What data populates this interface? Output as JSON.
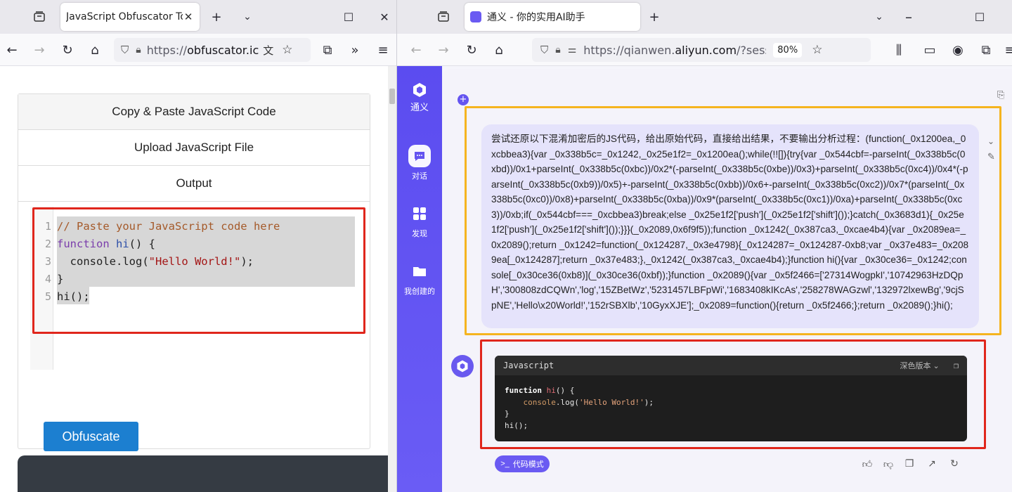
{
  "left_window": {
    "tab_title": "JavaScript Obfuscator Too",
    "url_prefix": "https://",
    "url_host": "obfuscator.ic",
    "page": {
      "accordion": [
        "Copy & Paste JavaScript Code",
        "Upload JavaScript File",
        "Output"
      ],
      "editor_lines": [
        {
          "num": "1"
        },
        {
          "num": "2"
        },
        {
          "num": "3"
        },
        {
          "num": "4"
        },
        {
          "num": "5"
        }
      ],
      "code": {
        "comment": "// Paste your JavaScript code here",
        "kw_function": "function",
        "fn_name": "hi",
        "sig_rest": "() {",
        "console_log": "  console.log(",
        "string": "\"Hello World!\"",
        "call_end": ");",
        "close_brace": "}",
        "call": "hi();"
      },
      "obfuscate_label": "Obfuscate"
    }
  },
  "right_window": {
    "tab_title": "通义 - 你的实用AI助手",
    "url_prefix": "https://qianwen.",
    "url_host": "aliyun.com",
    "url_rest": "/?sessionId=",
    "zoom": "80%",
    "sidebar": {
      "logo_label": "通义",
      "items": [
        {
          "label": "对话",
          "icon": "chat-icon"
        },
        {
          "label": "发现",
          "icon": "grid-icon"
        },
        {
          "label": "我创建的",
          "icon": "folder-icon"
        }
      ]
    },
    "user_message": "尝试还原以下混淆加密后的JS代码，给出原始代码，直接给出结果，不要输出分析过程：(function(_0x1200ea,_0xcbbea3){var _0x338b5c=_0x1242,_0x25e1f2=_0x1200ea();while(!![]){try{var _0x544cbf=-parseInt(_0x338b5c(0xbd))/0x1+parseInt(_0x338b5c(0xbc))/0x2*(-parseInt(_0x338b5c(0xbe))/0x3)+parseInt(_0x338b5c(0xc4))/0x4*(-parseInt(_0x338b5c(0xb9))/0x5)+-parseInt(_0x338b5c(0xbb))/0x6+-parseInt(_0x338b5c(0xc2))/0x7*(parseInt(_0x338b5c(0xc0))/0x8)+parseInt(_0x338b5c(0xba))/0x9*(parseInt(_0x338b5c(0xc1))/0xa)+parseInt(_0x338b5c(0xc3))/0xb;if(_0x544cbf===_0xcbbea3)break;else _0x25e1f2['push'](_0x25e1f2['shift']());}catch(_0x3683d1){_0x25e1f2['push'](_0x25e1f2['shift']());}}}(_0x2089,0x6f9f5));function _0x1242(_0x387ca3,_0xcae4b4){var _0x2089ea=_0x2089();return _0x1242=function(_0x124287,_0x3e4798){_0x124287=_0x124287-0xb8;var _0x37e483=_0x2089ea[_0x124287];return _0x37e483;},_0x1242(_0x387ca3,_0xcae4b4);}function hi(){var _0x30ce36=_0x1242;console[_0x30ce36(0xb8)](_0x30ce36(0xbf));}function _0x2089(){var _0x5f2466=['27314WogpkI','10742963HzDQpH','300808zdCQWn','log','15ZBetWz','5231457LBFpWi','1683408kIKcAs','258278WAGzwl','132972lxewBg','9cjSpNE','Hello\\x20World!','152rSBXlb','10GyxXJE'];_0x2089=function(){return _0x5f2466;};return _0x2089();}hi();",
    "code_card": {
      "language": "Javascript",
      "theme": "深色版本",
      "lines": {
        "kw_function": "function",
        "fn_name": "hi",
        "sig_rest": "() {",
        "indent_console": "    console",
        "log_call": ".log(",
        "string": "'Hello World!'",
        "call_end": ");",
        "close_brace": "}",
        "call": "hi();"
      }
    },
    "mode_button": "代码模式"
  },
  "colors": {
    "highlight_red": "#e0261c",
    "highlight_yellow": "#f5b41f",
    "brand_purple": "#6454f0",
    "obfuscate_blue": "#1c7fd0"
  }
}
